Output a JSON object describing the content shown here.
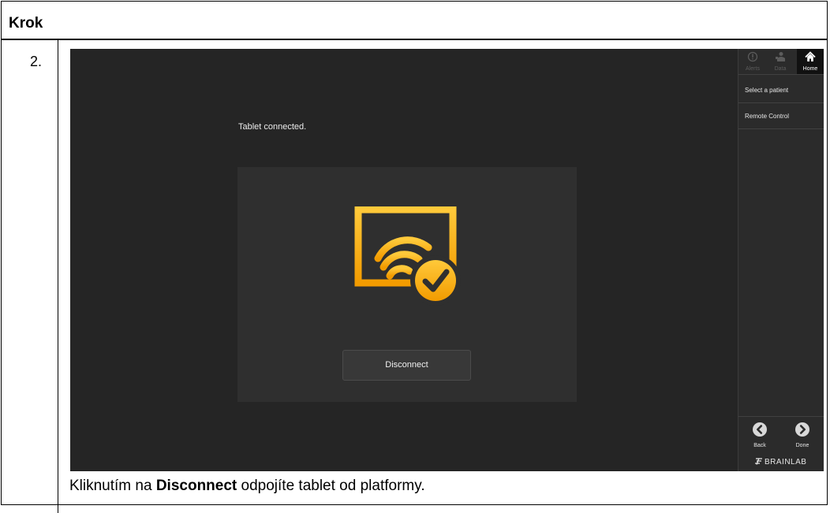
{
  "header": {
    "label": "Krok"
  },
  "step": {
    "number": "2.",
    "instruction_prefix": "Kliknutím na ",
    "instruction_bold": "Disconnect",
    "instruction_suffix": " odpojíte tablet od platformy."
  },
  "screen": {
    "status_text": "Tablet connected.",
    "disconnect_label": "Disconnect",
    "accent_color": "#f5b800"
  },
  "sidebar": {
    "top_icons": [
      {
        "label": "Alerts",
        "icon": "alert-icon",
        "active": false
      },
      {
        "label": "Data",
        "icon": "data-icon",
        "active": false
      },
      {
        "label": "Home",
        "icon": "home-icon",
        "active": true
      }
    ],
    "menu": [
      {
        "label": "Select a patient"
      },
      {
        "label": "Remote Control"
      }
    ],
    "back_label": "Back",
    "done_label": "Done",
    "brand": "BRAINLAB"
  }
}
